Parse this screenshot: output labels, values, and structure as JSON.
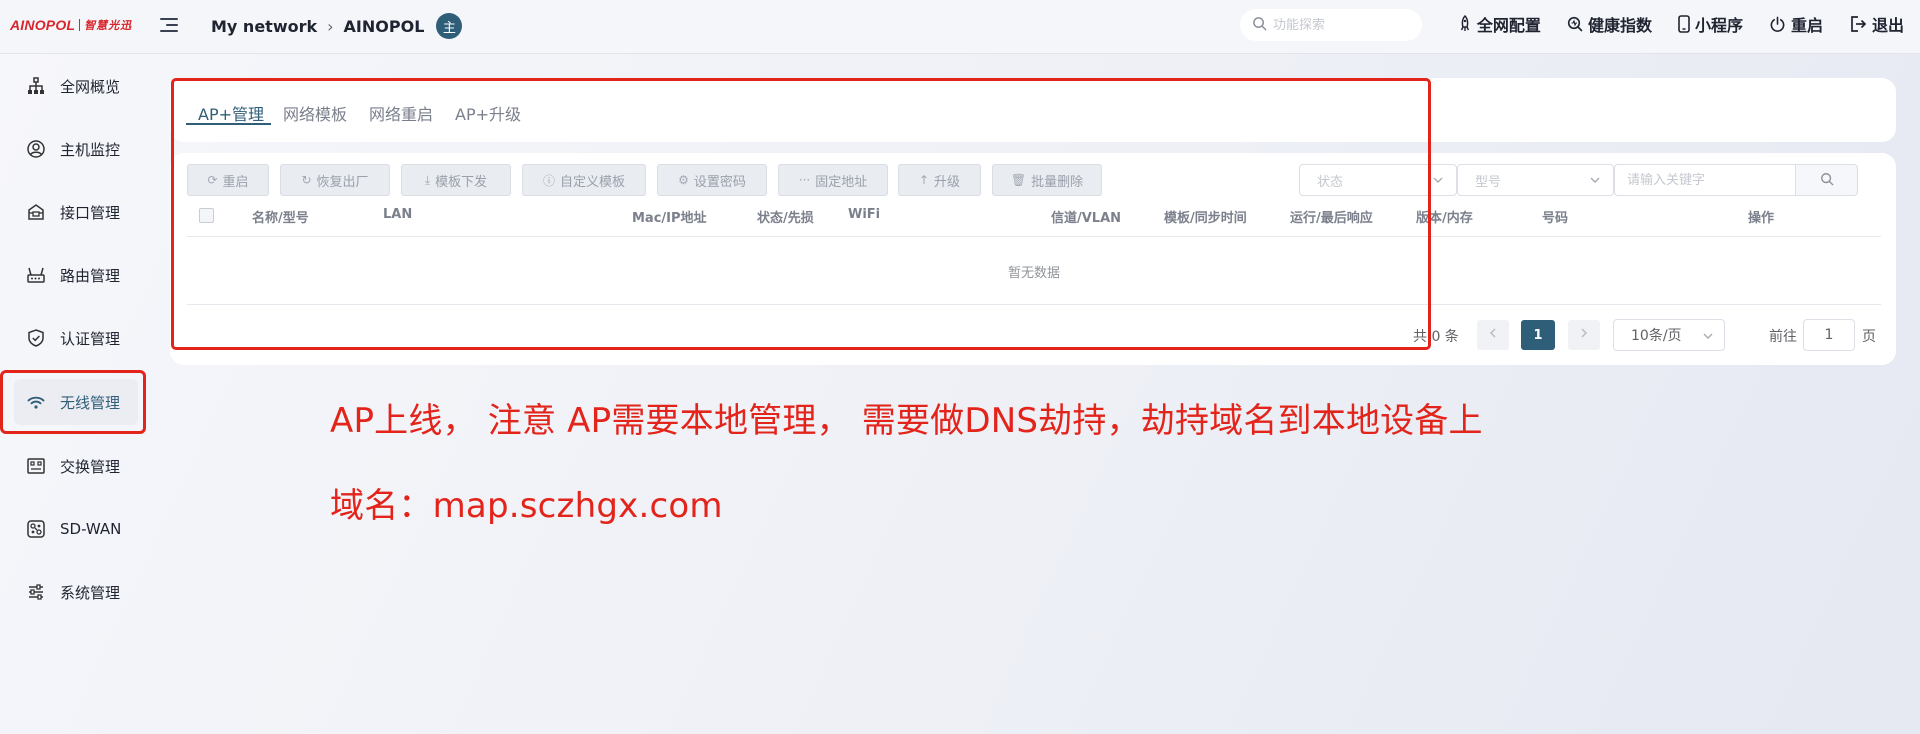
{
  "brand": {
    "name": "AINOPOL",
    "cn_name": "智慧光迅"
  },
  "header": {
    "breadcrumb_root": "My network",
    "breadcrumb_current": "AINOPOL",
    "breadcrumb_badge": "主",
    "search_placeholder": "功能探索",
    "actions": [
      {
        "label": "全网配置",
        "icon": "rocket-icon"
      },
      {
        "label": "健康指数",
        "icon": "health-search-icon"
      },
      {
        "label": "小程序",
        "icon": "phone-icon"
      },
      {
        "label": "重启",
        "icon": "power-icon"
      },
      {
        "label": "退出",
        "icon": "logout-icon"
      }
    ]
  },
  "sidebar": {
    "items": [
      {
        "label": "全网概览",
        "icon": "network-topology-icon"
      },
      {
        "label": "主机监控",
        "icon": "user-circle-icon"
      },
      {
        "label": "接口管理",
        "icon": "interface-icon"
      },
      {
        "label": "路由管理",
        "icon": "router-icon"
      },
      {
        "label": "认证管理",
        "icon": "shield-check-icon"
      },
      {
        "label": "无线管理",
        "icon": "wifi-icon",
        "active": true
      },
      {
        "label": "交换管理",
        "icon": "switch-icon"
      },
      {
        "label": "SD-WAN",
        "icon": "sdwan-icon"
      },
      {
        "label": "系统管理",
        "icon": "sliders-icon"
      }
    ]
  },
  "tabs": [
    {
      "label": "AP+管理",
      "active": true
    },
    {
      "label": "网络模板"
    },
    {
      "label": "网络重启"
    },
    {
      "label": "AP+升级"
    }
  ],
  "toolbar": {
    "buttons": [
      {
        "label": "重启",
        "icon": "refresh-icon"
      },
      {
        "label": "恢复出厂",
        "icon": "restore-icon"
      },
      {
        "label": "模板下发",
        "icon": "download-icon"
      },
      {
        "label": "自定义模板",
        "icon": "info-icon"
      },
      {
        "label": "设置密码",
        "icon": "gear-icon"
      },
      {
        "label": "固定地址",
        "icon": "more-icon"
      },
      {
        "label": "升级",
        "icon": "arrow-up-icon"
      },
      {
        "label": "批量删除",
        "icon": "trash-icon"
      }
    ],
    "status_placeholder": "状态",
    "model_placeholder": "型号",
    "keyword_placeholder": "请输入关键字"
  },
  "table": {
    "columns": [
      "名称/型号",
      "LAN",
      "Mac/IP地址",
      "状态/先损",
      "WiFi",
      "信道/VLAN",
      "模板/同步时间",
      "运行/最后响应",
      "版本/内存",
      "号码",
      "操作"
    ],
    "empty_text": "暂无数据",
    "rows": []
  },
  "pagination": {
    "total_text": "共 0 条",
    "current_page": "1",
    "page_size": "10条/页",
    "goto_label": "前往",
    "goto_value": "1",
    "goto_suffix": "页"
  },
  "annotations": {
    "line1": "AP上线， 注意 AP需要本地管理， 需要做DNS劫持，劫持域名到本地设备上",
    "line2": "域名：map.sczhgx.com",
    "color": "#e3241b"
  },
  "colors": {
    "accent": "#2f5e78",
    "brand_red": "#d8262c"
  }
}
